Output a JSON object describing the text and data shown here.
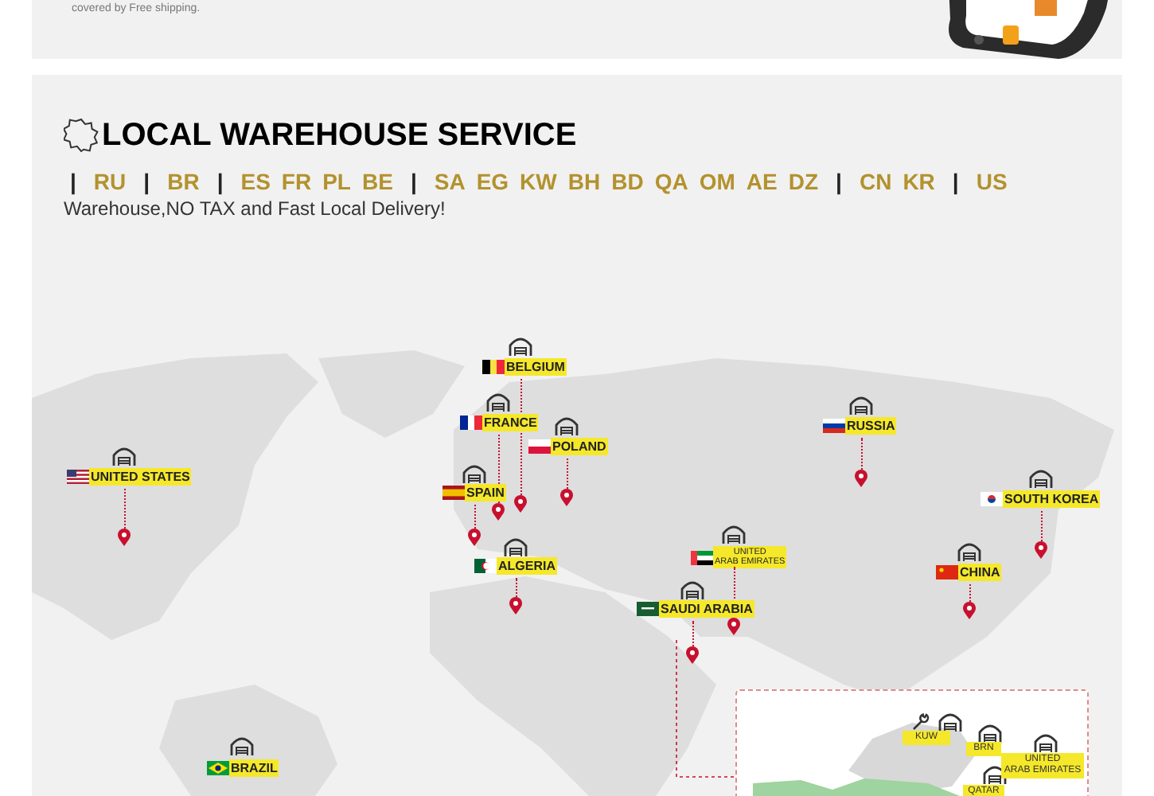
{
  "promo": {
    "note": "covered by Free shipping."
  },
  "section": {
    "title": "LOCAL WAREHOUSE SERVICE",
    "codes": [
      {
        "kind": "separator",
        "text": "|"
      },
      {
        "kind": "code",
        "text": "RU"
      },
      {
        "kind": "separator",
        "text": "|"
      },
      {
        "kind": "code",
        "text": "BR"
      },
      {
        "kind": "separator",
        "text": "|"
      },
      {
        "kind": "code",
        "text": "ES"
      },
      {
        "kind": "code",
        "text": "FR"
      },
      {
        "kind": "code",
        "text": "PL"
      },
      {
        "kind": "code",
        "text": "BE"
      },
      {
        "kind": "separator",
        "text": "|"
      },
      {
        "kind": "code",
        "text": "SA"
      },
      {
        "kind": "code",
        "text": "EG"
      },
      {
        "kind": "code",
        "text": "KW"
      },
      {
        "kind": "code",
        "text": "BH"
      },
      {
        "kind": "code",
        "text": "BD"
      },
      {
        "kind": "code",
        "text": "QA"
      },
      {
        "kind": "code",
        "text": "OM"
      },
      {
        "kind": "code",
        "text": "AE"
      },
      {
        "kind": "code",
        "text": "DZ"
      },
      {
        "kind": "separator",
        "text": "|"
      },
      {
        "kind": "code",
        "text": "CN"
      },
      {
        "kind": "code",
        "text": "KR"
      },
      {
        "kind": "separator",
        "text": "|"
      },
      {
        "kind": "code",
        "text": "US"
      }
    ],
    "subtitle": "Warehouse,NO TAX and Fast Local Delivery!"
  },
  "map": {
    "markers": [
      {
        "label": "BELGIUM"
      },
      {
        "label": "FRANCE"
      },
      {
        "label": "RUSSIA"
      },
      {
        "label": "POLAND"
      },
      {
        "label": "UNITED STATES"
      },
      {
        "label": "SPAIN"
      },
      {
        "label": "SOUTH KOREA"
      },
      {
        "label": "ALGERIA"
      },
      {
        "label": "UNITED\nARAB EMIRATES"
      },
      {
        "label": "CHINA"
      },
      {
        "label": "SAUDI ARABIA"
      },
      {
        "label": "BRAZIL"
      }
    ],
    "inset": {
      "labels": [
        "KUW",
        "BRN",
        "UNITED\nARAB EMIRATES",
        "QATAR"
      ]
    }
  }
}
